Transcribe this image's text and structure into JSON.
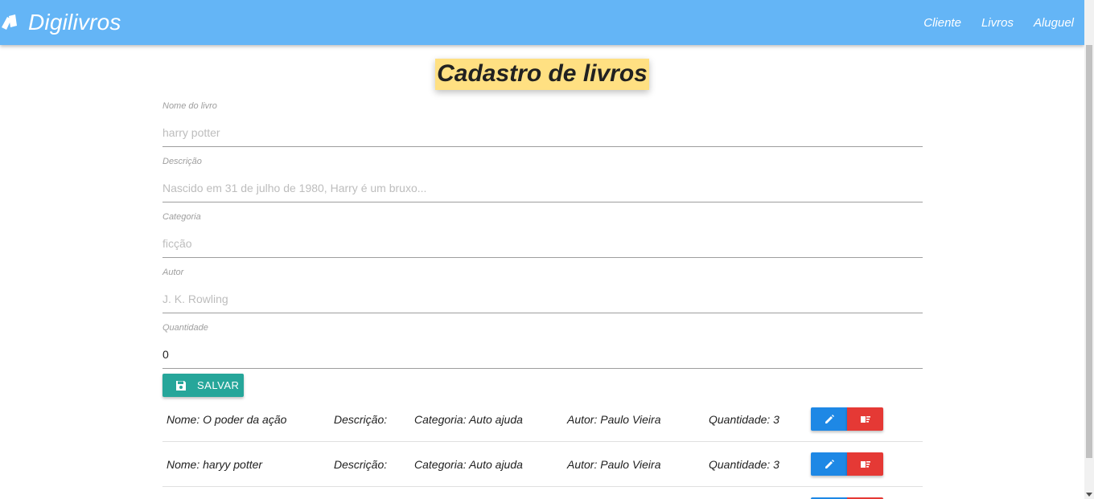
{
  "app": {
    "brand": "Digilivros"
  },
  "nav": {
    "items": [
      "Cliente",
      "Livros",
      "Aluguel"
    ]
  },
  "page": {
    "title": "Cadastro de livros"
  },
  "form": {
    "fields": [
      {
        "label": "Nome do livro",
        "placeholder": "harry potter",
        "value": ""
      },
      {
        "label": "Descrição",
        "placeholder": "Nascido em 31 de julho de 1980, Harry é um bruxo...",
        "value": ""
      },
      {
        "label": "Categoria",
        "placeholder": "ficção",
        "value": ""
      },
      {
        "label": "Autor",
        "placeholder": "J. K. Rowling",
        "value": ""
      },
      {
        "label": "Quantidade",
        "placeholder": "",
        "value": "0"
      }
    ],
    "save_label": "SALVAR"
  },
  "books": [
    {
      "nome": "Nome: O poder da ação",
      "descricao": "Descrição:",
      "categoria": "Categoria: Auto ajuda",
      "autor": "Autor: Paulo Vieira",
      "quantidade": "Quantidade: 3"
    },
    {
      "nome": "Nome: haryy potter",
      "descricao": "Descrição:",
      "categoria": "Categoria: Auto ajuda",
      "autor": "Autor: Paulo Vieira",
      "quantidade": "Quantidade: 3"
    }
  ],
  "colors": {
    "navbar": "#64b5f6",
    "title_bg": "#ffe082",
    "save": "#26a69a",
    "edit": "#1e88e5",
    "delete": "#e53935"
  }
}
